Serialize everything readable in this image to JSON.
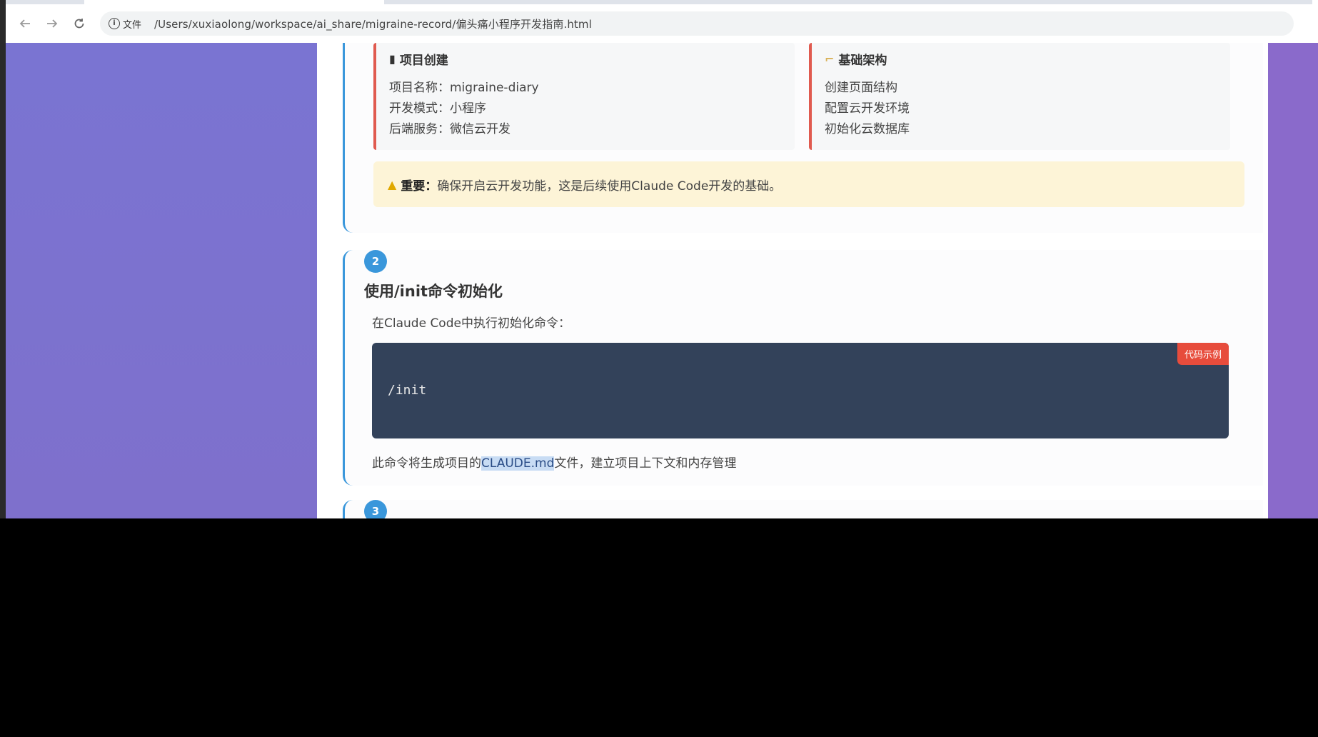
{
  "browser": {
    "site_info_label": "文件",
    "url": "/Users/xuxiaolong/workspace/ai_share/migraine-record/偏头痛小程序开发指南.html"
  },
  "step1": {
    "card_left": {
      "title": "项目创建",
      "icon": "phone-icon",
      "lines": [
        "项目名称：migraine-diary",
        "开发模式：小程序",
        "后端服务：微信云开发"
      ]
    },
    "card_right": {
      "title": "基础架构",
      "icon": "folder-icon",
      "lines": [
        "创建页面结构",
        "配置云开发环境",
        "初始化云数据库"
      ]
    },
    "warning": {
      "label": "重要：",
      "text": "确保开启云开发功能，这是后续使用Claude Code开发的基础。"
    }
  },
  "step2": {
    "number": "2",
    "title": "使用/init命令初始化",
    "description": "在Claude Code中执行初始化命令：",
    "code_badge": "代码示例",
    "code": "/init",
    "note_prefix": "此命令将生成项目的",
    "note_highlight": "CLAUDE.md",
    "note_suffix": "文件，建立项目上下文和内存管理"
  },
  "step3": {
    "number": "3"
  },
  "colors": {
    "accent_blue": "#3a97db",
    "card_border_red": "#e05a4f",
    "code_bg": "#33425a",
    "badge_red": "#e74c3c",
    "warning_bg": "#fdf4d7",
    "page_bg_purple": "#7a6fcf"
  }
}
